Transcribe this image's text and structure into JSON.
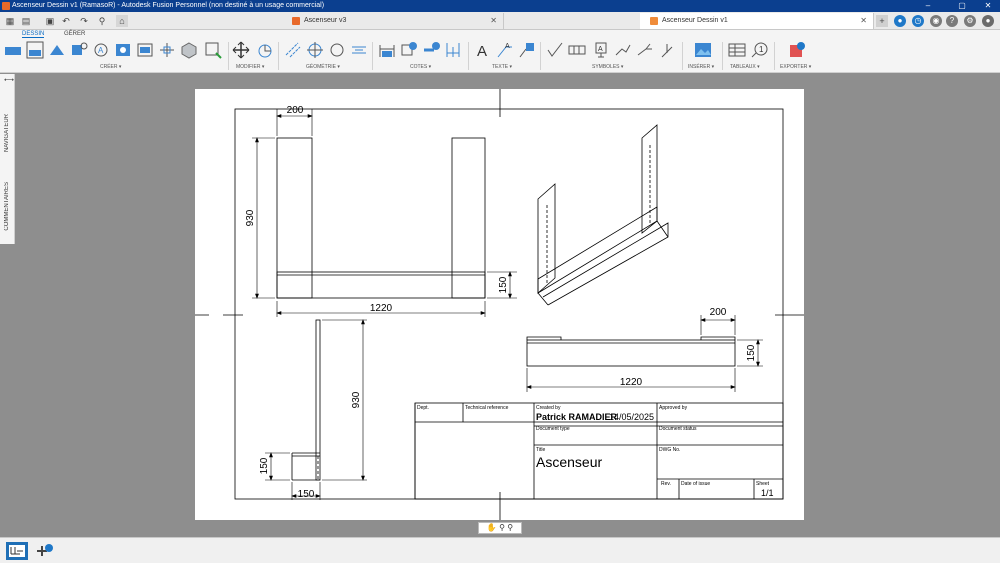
{
  "window": {
    "title": "Ascenseur Dessin v1 (RamasoR) - Autodesk Fusion Personnel (non destiné à un usage commercial)"
  },
  "tabs": [
    {
      "label": "Ascenseur v3"
    },
    {
      "label": "Ascenseur Dessin v1"
    }
  ],
  "ribbon": {
    "tabs": [
      "DESSIN",
      "GÉRER"
    ],
    "groups": [
      "CRÉER ▾",
      "MODIFIER ▾",
      "GÉOMÉTRIE ▾",
      "COTES ▾",
      "TEXTE ▾",
      "SYMBOLES ▾",
      "INSÉRER ▾",
      "TABLEAUX ▾",
      "EXPORTER ▾"
    ]
  },
  "side_panel": {
    "navigator": "NAVIGATEUR",
    "comments": "COMMENTAIRES"
  },
  "drawing": {
    "dims": {
      "front_width": "200",
      "front_height": "930",
      "front_total": "1220",
      "front_base": "150",
      "side_height": "930",
      "side_base_h": "150",
      "side_base_w": "150",
      "top_width": "200",
      "top_height": "150",
      "top_total": "1220"
    },
    "title_block": {
      "dept_label": "Dept.",
      "techref_label": "Technical reference",
      "created_by_label": "Created by",
      "created_by_value": "Patrick RAMADIER",
      "created_date": "14/05/2025",
      "approved_by_label": "Approved by",
      "doc_type_label": "Document type",
      "doc_status_label": "Document status",
      "title_label": "Title",
      "title_value": "Ascenseur",
      "dwg_no_label": "DWG No.",
      "rev_label": "Rev.",
      "date_issue_label": "Date of issue",
      "sheet_label": "Sheet",
      "sheet_value": "1/1"
    }
  },
  "colors": {
    "accent": "#0a6cc4",
    "titlebar": "#0b3f8f",
    "canvas": "#8e8e8e"
  }
}
